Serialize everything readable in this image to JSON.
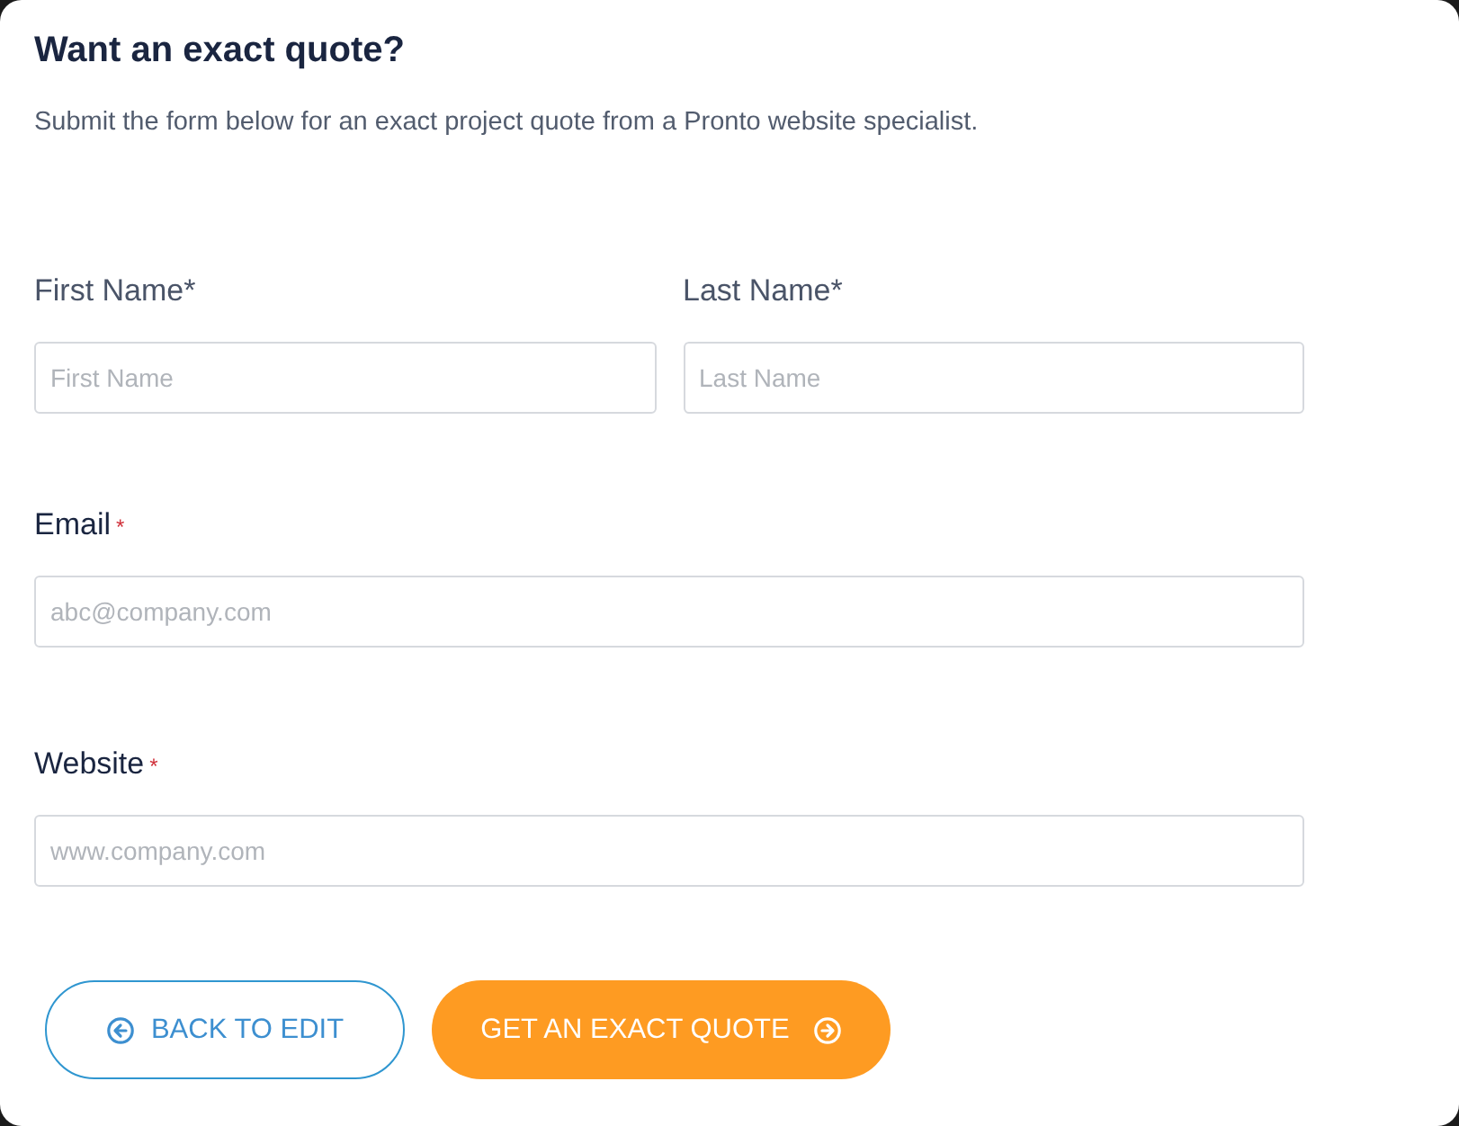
{
  "heading": "Want an exact quote?",
  "intro": "Submit the form below for an exact project quote from a Pronto website specialist.",
  "rows": [
    {
      "fields": [
        {
          "label": "First Name*",
          "placeholder": "First Name"
        },
        {
          "label": "Last Name*",
          "placeholder": "Last Name"
        }
      ]
    },
    {
      "fields": [
        {
          "label": "Email",
          "required_mark": "*",
          "placeholder": "abc@company.com"
        }
      ]
    },
    {
      "fields": [
        {
          "label": "Website",
          "required_mark": "*",
          "placeholder": "www.company.com"
        }
      ]
    }
  ],
  "buttons": [
    {
      "kind": "back",
      "label": "BACK TO EDIT"
    },
    {
      "kind": "submit",
      "label": "GET AN EXACT QUOTE"
    }
  ]
}
